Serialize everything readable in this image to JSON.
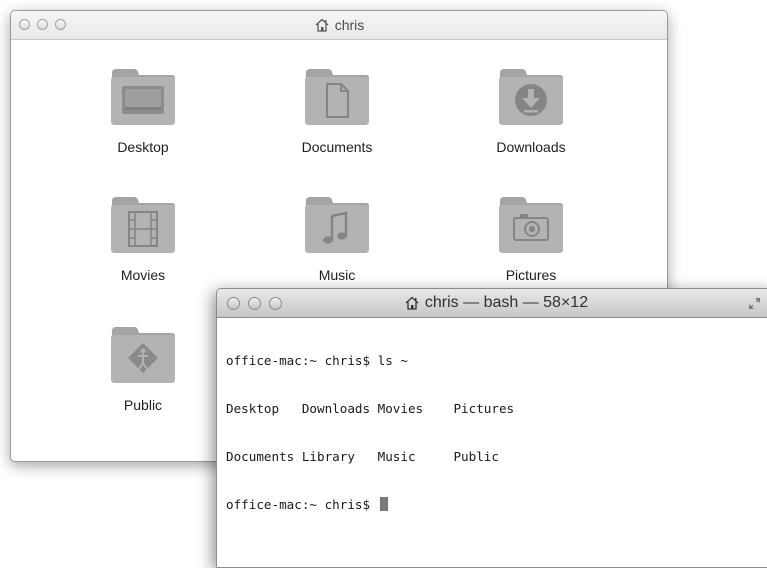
{
  "finder": {
    "title": "chris",
    "items": [
      {
        "label": "Desktop",
        "icon": "desktop-folder-icon"
      },
      {
        "label": "Documents",
        "icon": "documents-folder-icon"
      },
      {
        "label": "Downloads",
        "icon": "downloads-folder-icon"
      },
      {
        "label": "Movies",
        "icon": "movies-folder-icon"
      },
      {
        "label": "Music",
        "icon": "music-folder-icon"
      },
      {
        "label": "Pictures",
        "icon": "pictures-folder-icon"
      },
      {
        "label": "Public",
        "icon": "public-folder-icon"
      }
    ]
  },
  "terminal": {
    "title": "chris — bash — 58×12",
    "lines": [
      "office-mac:~ chris$ ls ~",
      "Desktop   Downloads Movies    Pictures",
      "Documents Library   Music     Public",
      "office-mac:~ chris$ "
    ]
  },
  "colors": {
    "folder_body": "#a9a9a9",
    "folder_tab": "#9a9a9a",
    "cursor": "#7a7a7a"
  }
}
